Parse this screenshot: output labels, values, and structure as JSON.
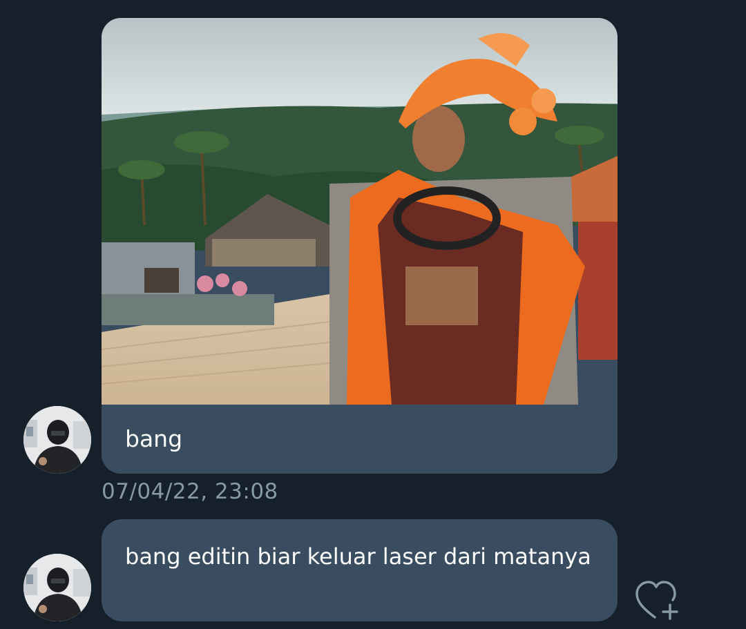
{
  "thread": {
    "messages": [
      {
        "kind": "media",
        "photo_alt": "photo",
        "text": "bang"
      },
      {
        "kind": "text",
        "text": "bang editin biar keluar laser dari matanya"
      }
    ],
    "timestamp": "07/04/22, 23:08"
  },
  "colors": {
    "background": "#15202b",
    "bubble": "#3a4d60",
    "timestamp_text": "#8899a6",
    "icon": "#8899a6"
  },
  "icons": {
    "react": "heart-plus-icon"
  }
}
